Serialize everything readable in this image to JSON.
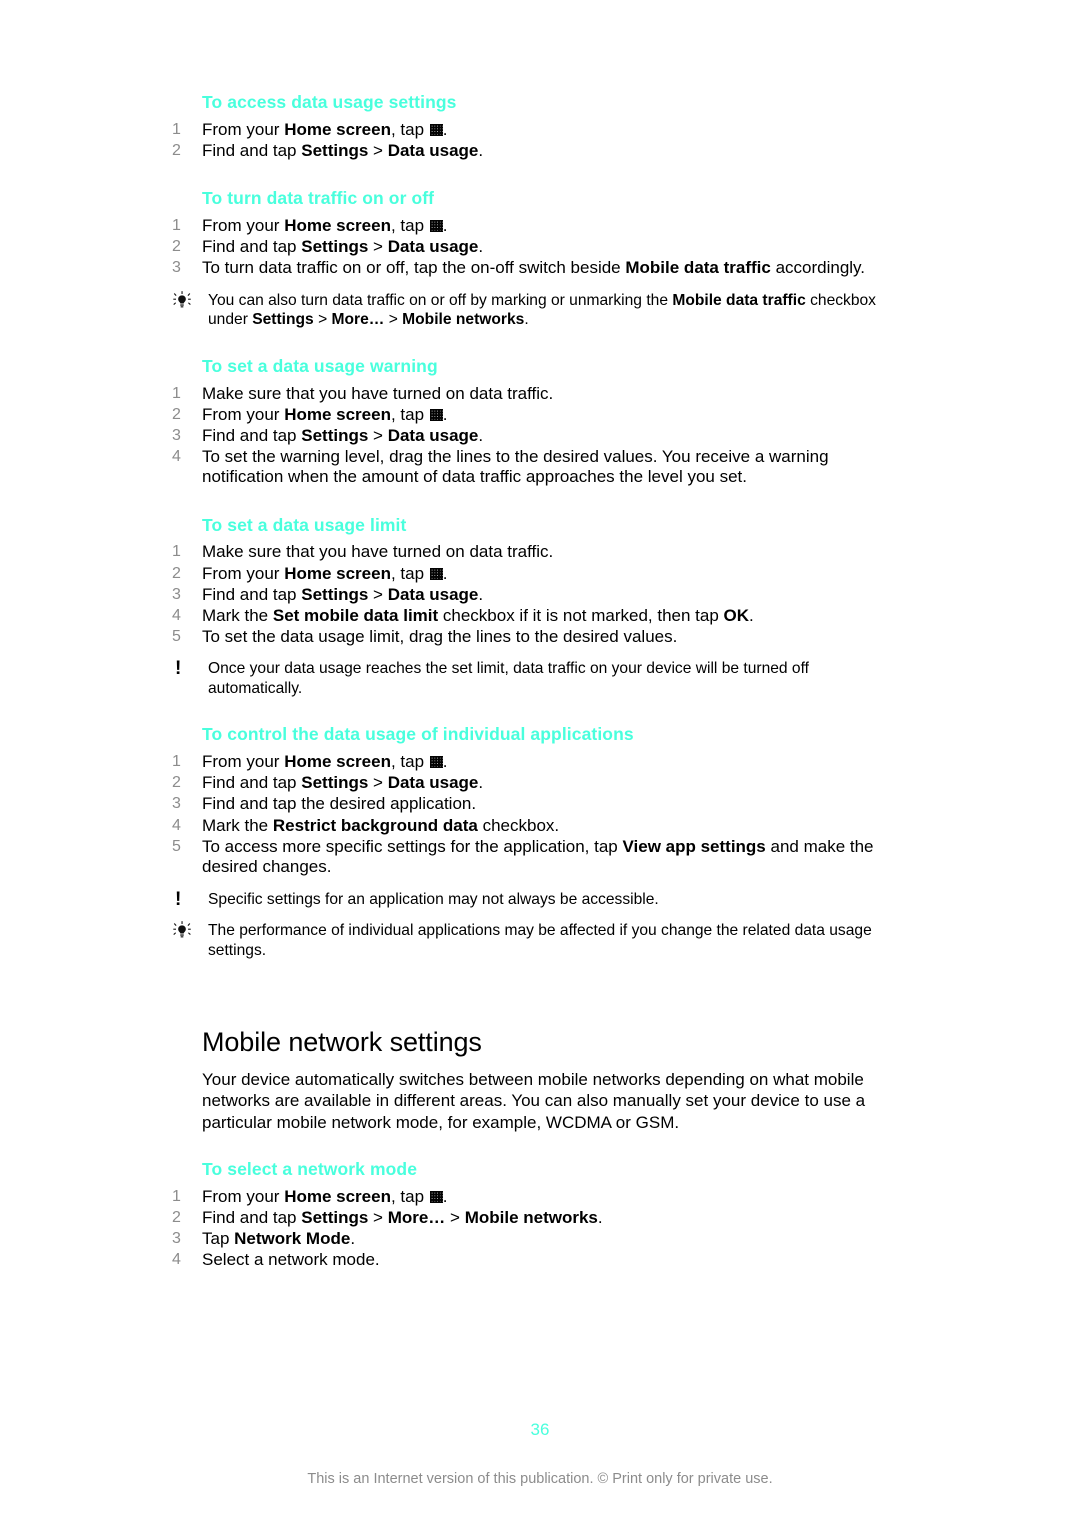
{
  "page": {
    "number": "36",
    "footer_text": "This is an Internet version of this publication. © Print only for private use."
  },
  "sections": [
    {
      "heading": "To access data usage settings",
      "steps": [
        {
          "num": "1",
          "html": "From your <b>Home screen</b>, tap <span class=\"appgrid\" data-name=\"app-drawer-icon\" data-interactable=\"false\"></span>."
        },
        {
          "num": "2",
          "html": "Find and tap <b>Settings</b> > <b>Data usage</b>."
        }
      ]
    },
    {
      "heading": "To turn data traffic on or off",
      "steps": [
        {
          "num": "1",
          "html": "From your <b>Home screen</b>, tap <span class=\"appgrid\" data-name=\"app-drawer-icon\" data-interactable=\"false\"></span>."
        },
        {
          "num": "2",
          "html": "Find and tap <b>Settings</b> > <b>Data usage</b>."
        },
        {
          "num": "3",
          "html": "To turn data traffic on or off, tap the on-off switch beside <b>Mobile data traffic</b> accordingly."
        }
      ],
      "callouts": [
        {
          "type": "tip",
          "icon": "lightbulb-icon",
          "html": "You can also turn data traffic on or off by marking or unmarking the <b>Mobile data traffic</b> checkbox under <b>Settings</b> > <b>More…</b> > <b>Mobile networks</b>."
        }
      ]
    },
    {
      "heading": "To set a data usage warning",
      "steps": [
        {
          "num": "1",
          "html": "Make sure that you have turned on data traffic."
        },
        {
          "num": "2",
          "html": "From your <b>Home screen</b>, tap <span class=\"appgrid\" data-name=\"app-drawer-icon\" data-interactable=\"false\"></span>."
        },
        {
          "num": "3",
          "html": "Find and tap <b>Settings</b> > <b>Data usage</b>."
        },
        {
          "num": "4",
          "html": "To set the warning level, drag the lines to the desired values. You receive a warning notification when the amount of data traffic approaches the level you set."
        }
      ]
    },
    {
      "heading": "To set a data usage limit",
      "steps": [
        {
          "num": "1",
          "html": "Make sure that you have turned on data traffic."
        },
        {
          "num": "2",
          "html": "From your <b>Home screen</b>, tap <span class=\"appgrid\" data-name=\"app-drawer-icon\" data-interactable=\"false\"></span>."
        },
        {
          "num": "3",
          "html": "Find and tap <b>Settings</b> > <b>Data usage</b>."
        },
        {
          "num": "4",
          "html": "Mark the <b>Set mobile data limit</b> checkbox if it is not marked, then tap <b>OK</b>."
        },
        {
          "num": "5",
          "html": "To set the data usage limit, drag the lines to the desired values."
        }
      ],
      "callouts": [
        {
          "type": "note",
          "icon": "exclamation-icon",
          "html": "Once your data usage reaches the set limit, data traffic on your device will be turned off automatically."
        }
      ]
    },
    {
      "heading": "To control the data usage of individual applications",
      "steps": [
        {
          "num": "1",
          "html": "From your <b>Home screen</b>, tap <span class=\"appgrid\" data-name=\"app-drawer-icon\" data-interactable=\"false\"></span>."
        },
        {
          "num": "2",
          "html": "Find and tap <b>Settings</b> > <b>Data usage</b>."
        },
        {
          "num": "3",
          "html": "Find and tap the desired application."
        },
        {
          "num": "4",
          "html": "Mark the <b>Restrict background data</b> checkbox."
        },
        {
          "num": "5",
          "html": "To access more specific settings for the application, tap <b>View app settings</b> and make the desired changes."
        }
      ],
      "callouts": [
        {
          "type": "note",
          "icon": "exclamation-icon",
          "html": "Specific settings for an application may not always be accessible."
        },
        {
          "type": "tip",
          "icon": "lightbulb-icon",
          "html": "The performance of individual applications may be affected if you change the related data usage settings."
        }
      ]
    }
  ],
  "chapter": {
    "title": "Mobile network settings",
    "intro": "Your device automatically switches between mobile networks depending on what mobile networks are available in different areas. You can also manually set your device to use a particular mobile network mode, for example, WCDMA or GSM.",
    "sections": [
      {
        "heading": "To select a network mode",
        "steps": [
          {
            "num": "1",
            "html": "From your <b>Home screen</b>, tap <span class=\"appgrid\" data-name=\"app-drawer-icon\" data-interactable=\"false\"></span>."
          },
          {
            "num": "2",
            "html": "Find and tap <b>Settings</b> > <b>More…</b> > <b>Mobile networks</b>."
          },
          {
            "num": "3",
            "html": "Tap <b>Network Mode</b>."
          },
          {
            "num": "4",
            "html": "Select a network mode."
          }
        ]
      }
    ]
  },
  "colors": {
    "heading_cyan": "#49ffdd",
    "step_number_gray": "#8c8c8c",
    "body_black": "#000000",
    "footer_gray": "#8c8c8c"
  }
}
